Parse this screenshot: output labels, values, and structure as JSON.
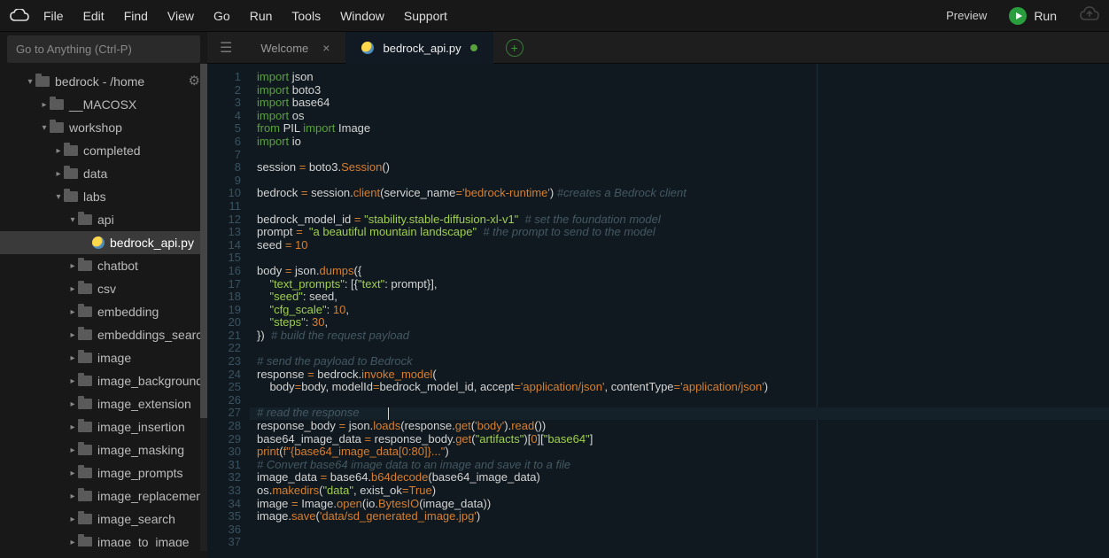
{
  "menu": [
    "File",
    "Edit",
    "Find",
    "View",
    "Go",
    "Run",
    "Tools",
    "Window",
    "Support"
  ],
  "topbar": {
    "preview": "Preview",
    "run": "Run"
  },
  "goto_placeholder": "Go to Anything (Ctrl-P)",
  "tree": [
    {
      "depth": 0,
      "caret": "down",
      "icon": "folder",
      "label": "bedrock - /home"
    },
    {
      "depth": 1,
      "caret": "right",
      "icon": "folder",
      "label": "__MACOSX"
    },
    {
      "depth": 1,
      "caret": "down",
      "icon": "folder",
      "label": "workshop"
    },
    {
      "depth": 2,
      "caret": "right",
      "icon": "folder",
      "label": "completed"
    },
    {
      "depth": 2,
      "caret": "right",
      "icon": "folder",
      "label": "data"
    },
    {
      "depth": 2,
      "caret": "down",
      "icon": "folder",
      "label": "labs"
    },
    {
      "depth": 3,
      "caret": "down",
      "icon": "folder",
      "label": "api"
    },
    {
      "depth": 4,
      "caret": "",
      "icon": "py",
      "label": "bedrock_api.py",
      "active": true
    },
    {
      "depth": 3,
      "caret": "right",
      "icon": "folder",
      "label": "chatbot"
    },
    {
      "depth": 3,
      "caret": "right",
      "icon": "folder",
      "label": "csv"
    },
    {
      "depth": 3,
      "caret": "right",
      "icon": "folder",
      "label": "embedding"
    },
    {
      "depth": 3,
      "caret": "right",
      "icon": "folder",
      "label": "embeddings_search"
    },
    {
      "depth": 3,
      "caret": "right",
      "icon": "folder",
      "label": "image"
    },
    {
      "depth": 3,
      "caret": "right",
      "icon": "folder",
      "label": "image_background"
    },
    {
      "depth": 3,
      "caret": "right",
      "icon": "folder",
      "label": "image_extension"
    },
    {
      "depth": 3,
      "caret": "right",
      "icon": "folder",
      "label": "image_insertion"
    },
    {
      "depth": 3,
      "caret": "right",
      "icon": "folder",
      "label": "image_masking"
    },
    {
      "depth": 3,
      "caret": "right",
      "icon": "folder",
      "label": "image_prompts"
    },
    {
      "depth": 3,
      "caret": "right",
      "icon": "folder",
      "label": "image_replacement"
    },
    {
      "depth": 3,
      "caret": "right",
      "icon": "folder",
      "label": "image_search"
    },
    {
      "depth": 3,
      "caret": "right",
      "icon": "folder",
      "label": "image_to_image"
    }
  ],
  "tabs": [
    {
      "label": "Welcome",
      "kind": "welcome",
      "active": false,
      "close": true
    },
    {
      "label": "bedrock_api.py",
      "kind": "python",
      "active": true,
      "dirty": true
    }
  ],
  "code_lines": [
    [
      [
        "k-imp",
        "import"
      ],
      [
        "k-id",
        " json"
      ]
    ],
    [
      [
        "k-imp",
        "import"
      ],
      [
        "k-id",
        " boto3"
      ]
    ],
    [
      [
        "k-imp",
        "import"
      ],
      [
        "k-id",
        " base64"
      ]
    ],
    [
      [
        "k-imp",
        "import"
      ],
      [
        "k-id",
        " os"
      ]
    ],
    [
      [
        "k-from",
        "from"
      ],
      [
        "k-id",
        " PIL "
      ],
      [
        "k-imp",
        "import"
      ],
      [
        "k-id",
        " Image"
      ]
    ],
    [
      [
        "k-imp",
        "import"
      ],
      [
        "k-id",
        " io"
      ]
    ],
    [],
    [
      [
        "k-id",
        "session "
      ],
      [
        "k-op",
        "="
      ],
      [
        "k-id",
        " boto3."
      ],
      [
        "k-func",
        "Session"
      ],
      [
        "k-id",
        "()"
      ]
    ],
    [],
    [
      [
        "k-id",
        "bedrock "
      ],
      [
        "k-op",
        "="
      ],
      [
        "k-id",
        " session."
      ],
      [
        "k-func",
        "client"
      ],
      [
        "k-id",
        "(service_name"
      ],
      [
        "k-op",
        "="
      ],
      [
        "k-str",
        "'bedrock-runtime'"
      ],
      [
        "k-id",
        ") "
      ],
      [
        "k-cmt",
        "#creates a Bedrock client"
      ]
    ],
    [],
    [
      [
        "k-id",
        "bedrock_model_id "
      ],
      [
        "k-op",
        "="
      ],
      [
        "k-id",
        " "
      ],
      [
        "k-lit",
        "\"stability.stable-diffusion-xl-v1\""
      ],
      [
        "k-id",
        "  "
      ],
      [
        "k-cmt",
        "# set the foundation model"
      ]
    ],
    [
      [
        "k-id",
        "prompt "
      ],
      [
        "k-op",
        "="
      ],
      [
        "k-id",
        "  "
      ],
      [
        "k-lit",
        "\"a beautiful mountain landscape\""
      ],
      [
        "k-id",
        "  "
      ],
      [
        "k-cmt",
        "# the prompt to send to the model"
      ]
    ],
    [
      [
        "k-id",
        "seed "
      ],
      [
        "k-op",
        "="
      ],
      [
        "k-id",
        " "
      ],
      [
        "k-num",
        "10"
      ]
    ],
    [],
    [
      [
        "k-id",
        "body "
      ],
      [
        "k-op",
        "="
      ],
      [
        "k-id",
        " json."
      ],
      [
        "k-func",
        "dumps"
      ],
      [
        "k-id",
        "({"
      ]
    ],
    [
      [
        "k-id",
        "    "
      ],
      [
        "k-lit",
        "\"text_prompts\""
      ],
      [
        "k-id",
        ": [{"
      ],
      [
        "k-lit",
        "\"text\""
      ],
      [
        "k-id",
        ": prompt}],"
      ]
    ],
    [
      [
        "k-id",
        "    "
      ],
      [
        "k-lit",
        "\"seed\""
      ],
      [
        "k-id",
        ": seed,"
      ]
    ],
    [
      [
        "k-id",
        "    "
      ],
      [
        "k-lit",
        "\"cfg_scale\""
      ],
      [
        "k-id",
        ": "
      ],
      [
        "k-num",
        "10"
      ],
      [
        "k-id",
        ","
      ]
    ],
    [
      [
        "k-id",
        "    "
      ],
      [
        "k-lit",
        "\"steps\""
      ],
      [
        "k-id",
        ": "
      ],
      [
        "k-num",
        "30"
      ],
      [
        "k-id",
        ","
      ]
    ],
    [
      [
        "k-id",
        "})  "
      ],
      [
        "k-cmt",
        "# build the request payload"
      ]
    ],
    [],
    [
      [
        "k-cmt",
        "# send the payload to Bedrock"
      ]
    ],
    [
      [
        "k-id",
        "response "
      ],
      [
        "k-op",
        "="
      ],
      [
        "k-id",
        " bedrock."
      ],
      [
        "k-func",
        "invoke_model"
      ],
      [
        "k-id",
        "("
      ]
    ],
    [
      [
        "k-id",
        "    body"
      ],
      [
        "k-op",
        "="
      ],
      [
        "k-id",
        "body, modelId"
      ],
      [
        "k-op",
        "="
      ],
      [
        "k-id",
        "bedrock_model_id, accept"
      ],
      [
        "k-op",
        "="
      ],
      [
        "k-str",
        "'application/json'"
      ],
      [
        "k-id",
        ", contentType"
      ],
      [
        "k-op",
        "="
      ],
      [
        "k-str",
        "'application/json'"
      ],
      [
        "k-id",
        ")"
      ]
    ],
    [],
    [
      [
        "k-cmt",
        "# read the response"
      ]
    ],
    [
      [
        "k-id",
        "response_body "
      ],
      [
        "k-op",
        "="
      ],
      [
        "k-id",
        " json."
      ],
      [
        "k-func",
        "loads"
      ],
      [
        "k-id",
        "(response."
      ],
      [
        "k-func",
        "get"
      ],
      [
        "k-id",
        "("
      ],
      [
        "k-str",
        "'body'"
      ],
      [
        "k-id",
        ")."
      ],
      [
        "k-func",
        "read"
      ],
      [
        "k-id",
        "())"
      ]
    ],
    [
      [
        "k-id",
        "base64_image_data "
      ],
      [
        "k-op",
        "="
      ],
      [
        "k-id",
        " response_body."
      ],
      [
        "k-func",
        "get"
      ],
      [
        "k-id",
        "("
      ],
      [
        "k-lit",
        "\"artifacts\""
      ],
      [
        "k-id",
        ")["
      ],
      [
        "k-num",
        "0"
      ],
      [
        "k-id",
        "]["
      ],
      [
        "k-lit",
        "\"base64\""
      ],
      [
        "k-id",
        "]"
      ]
    ],
    [
      [
        "k-sp",
        "print"
      ],
      [
        "k-id",
        "("
      ],
      [
        "k-str",
        "f\"{base64_image_data[0:80]}...\""
      ],
      [
        "k-id",
        ")"
      ]
    ],
    [
      [
        "k-cmt",
        "# Convert base64 image data to an image and save it to a file"
      ]
    ],
    [
      [
        "k-id",
        "image_data "
      ],
      [
        "k-op",
        "="
      ],
      [
        "k-id",
        " base64."
      ],
      [
        "k-func",
        "b64decode"
      ],
      [
        "k-id",
        "(base64_image_data)"
      ]
    ],
    [
      [
        "k-id",
        "os."
      ],
      [
        "k-func",
        "makedirs"
      ],
      [
        "k-id",
        "("
      ],
      [
        "k-lit",
        "\"data\""
      ],
      [
        "k-id",
        ", exist_ok"
      ],
      [
        "k-op",
        "="
      ],
      [
        "k-sp",
        "True"
      ],
      [
        "k-id",
        ")"
      ]
    ],
    [
      [
        "k-id",
        "image "
      ],
      [
        "k-op",
        "="
      ],
      [
        "k-id",
        " Image."
      ],
      [
        "k-func",
        "open"
      ],
      [
        "k-id",
        "(io."
      ],
      [
        "k-func",
        "BytesIO"
      ],
      [
        "k-id",
        "(image_data))"
      ]
    ],
    [
      [
        "k-id",
        "image."
      ],
      [
        "k-func",
        "save"
      ],
      [
        "k-id",
        "("
      ],
      [
        "k-str",
        "'data/sd_generated_image.jpg'"
      ],
      [
        "k-id",
        ")"
      ]
    ],
    [],
    []
  ]
}
